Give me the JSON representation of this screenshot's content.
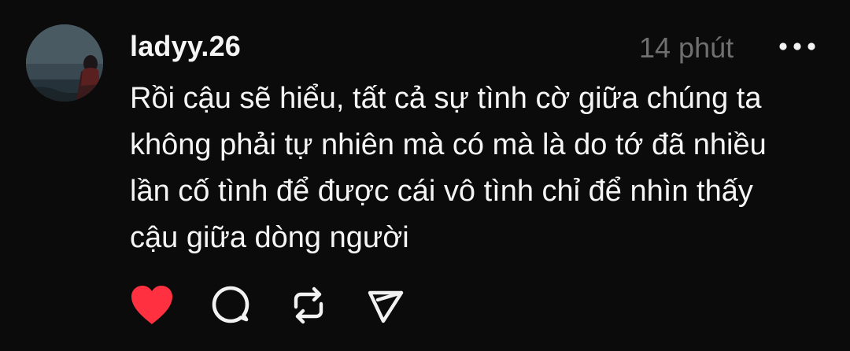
{
  "post": {
    "username": "ladyy.26",
    "timestamp": "14 phút",
    "text_lines": [
      "Rồi cậu sẽ hiểu, tất cả sự tình cờ giữa chúng ta",
      "không phải tự nhiên mà có mà là do tớ đã nhiều",
      "lần cố tình để được cái vô tình chỉ để nhìn thấy",
      "cậu giữa dòng người"
    ],
    "liked": true
  },
  "icons": {
    "more": "more-horizontal-icon",
    "like": "heart-filled-icon",
    "reply": "comment-bubble-icon",
    "repost": "repost-icon",
    "share": "send-icon"
  },
  "colors": {
    "background": "#0b0b0b",
    "text": "#f5f5f5",
    "muted": "#6f6f6f",
    "like": "#ff3040"
  }
}
